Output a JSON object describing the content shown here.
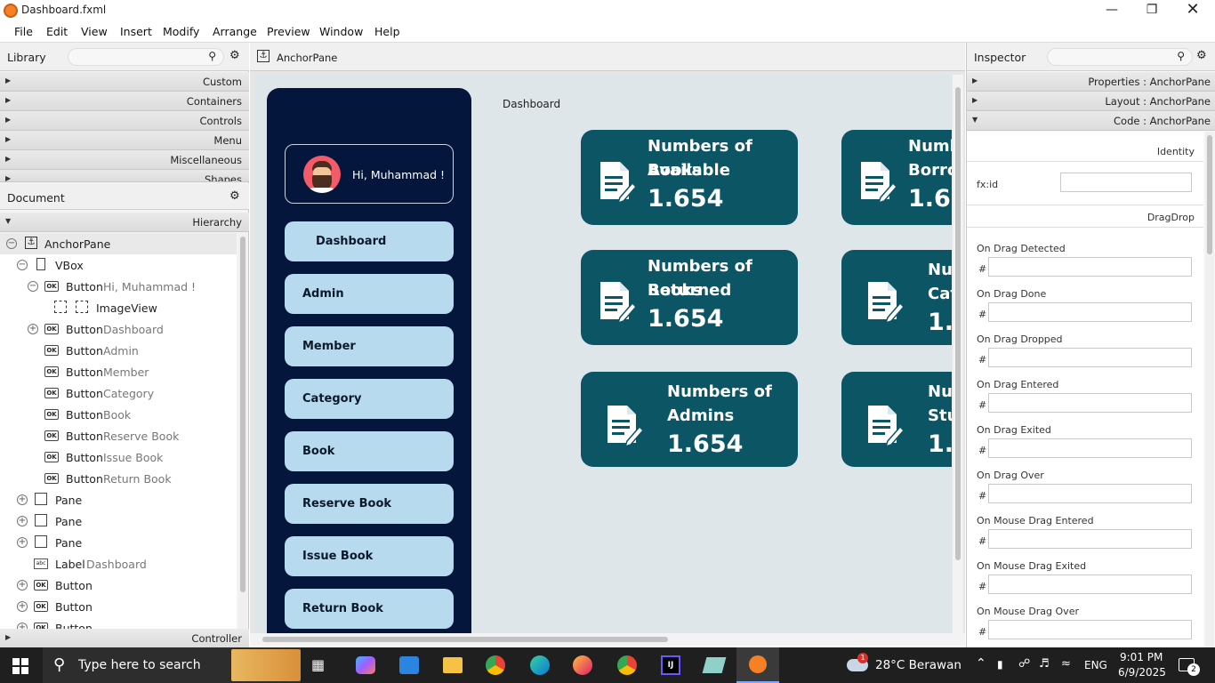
{
  "window": {
    "title": "Dashboard.fxml"
  },
  "menubar": [
    "File",
    "Edit",
    "View",
    "Insert",
    "Modify",
    "Arrange",
    "Preview",
    "Window",
    "Help"
  ],
  "library": {
    "title": "Library",
    "sections": [
      "Custom",
      "Containers",
      "Controls",
      "Menu",
      "Miscellaneous",
      "Shapes"
    ]
  },
  "document": {
    "title": "Document",
    "hierarchy_label": "Hierarchy",
    "controller_label": "Controller",
    "rows": [
      {
        "type": "AnchorPane",
        "name": ""
      },
      {
        "type": "VBox",
        "name": ""
      },
      {
        "type": "Button",
        "name": "Hi, Muhammad !"
      },
      {
        "type": "ImageView",
        "name": ""
      },
      {
        "type": "Button",
        "name": "Dashboard"
      },
      {
        "type": "Button",
        "name": "Admin"
      },
      {
        "type": "Button",
        "name": "Member"
      },
      {
        "type": "Button",
        "name": "Category"
      },
      {
        "type": "Button",
        "name": "Book"
      },
      {
        "type": "Button",
        "name": "Reserve Book"
      },
      {
        "type": "Button",
        "name": "Issue Book"
      },
      {
        "type": "Button",
        "name": "Return Book"
      },
      {
        "type": "Pane",
        "name": ""
      },
      {
        "type": "Pane",
        "name": ""
      },
      {
        "type": "Pane",
        "name": ""
      },
      {
        "type": "Label",
        "name": "Dashboard"
      },
      {
        "type": "Button",
        "name": ""
      },
      {
        "type": "Button",
        "name": ""
      },
      {
        "type": "Button",
        "name": ""
      }
    ]
  },
  "editor": {
    "breadcrumb": "AnchorPane",
    "dashboard_label": "Dashboard",
    "greeting": "Hi, Muhammad !",
    "nav": [
      "Dashboard",
      "Admin",
      "Member",
      "Category",
      "Book",
      "Reserve Book",
      "Issue Book",
      "Return Book"
    ],
    "cards": [
      {
        "line1": "Numbers of Books",
        "line2": "Available",
        "value": "1.654"
      },
      {
        "line1": "Numb",
        "line2": "Borro",
        "value": "1.65"
      },
      {
        "line1": "Numbers of Books",
        "line2": "Returned",
        "value": "1.654"
      },
      {
        "line1": "Nu",
        "line2": "Cat",
        "value": "1."
      },
      {
        "line1": "Numbers of",
        "line2": "Admins",
        "value": "1.654"
      },
      {
        "line1": "Nu",
        "line2": "Stu",
        "value": "1."
      }
    ]
  },
  "inspector": {
    "title": "Inspector",
    "sections": [
      "Properties : AnchorPane",
      "Layout : AnchorPane",
      "Code : AnchorPane"
    ],
    "identity": "Identity",
    "fxid": "fx:id",
    "dragdrop": "DragDrop",
    "hash": "#",
    "events": [
      "On Drag Detected",
      "On Drag Done",
      "On Drag Dropped",
      "On Drag Entered",
      "On Drag Exited",
      "On Drag Over",
      "On Mouse Drag Entered",
      "On Mouse Drag Exited",
      "On Mouse Drag Over"
    ]
  },
  "taskbar": {
    "search_placeholder": "Type here to search",
    "weather": "28°C  Berawan",
    "weather_badge": "1",
    "lang": "ENG",
    "time": "9:01 PM",
    "date": "6/9/2025",
    "notif_count": "2"
  },
  "colors": {
    "sidebar": "#04163b",
    "navbtn": "#b7daee",
    "card": "#0c5565",
    "anchor_bg": "#dfe6e9"
  }
}
